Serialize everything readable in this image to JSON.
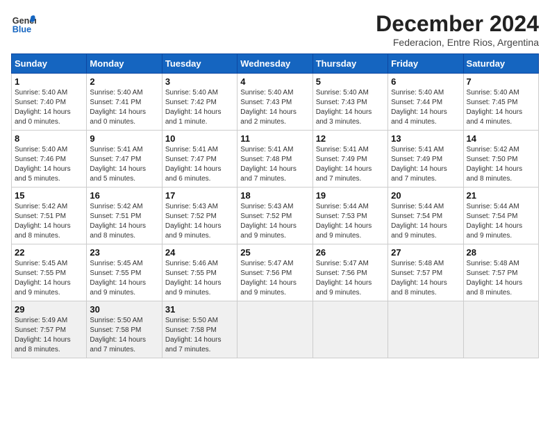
{
  "header": {
    "logo_general": "General",
    "logo_blue": "Blue",
    "month_title": "December 2024",
    "subtitle": "Federacion, Entre Rios, Argentina"
  },
  "calendar": {
    "weekdays": [
      "Sunday",
      "Monday",
      "Tuesday",
      "Wednesday",
      "Thursday",
      "Friday",
      "Saturday"
    ],
    "days": [
      {
        "date": "1",
        "col": 0,
        "info": "Sunrise: 5:40 AM\nSunset: 7:40 PM\nDaylight: 14 hours\nand 0 minutes."
      },
      {
        "date": "2",
        "col": 1,
        "info": "Sunrise: 5:40 AM\nSunset: 7:41 PM\nDaylight: 14 hours\nand 0 minutes."
      },
      {
        "date": "3",
        "col": 2,
        "info": "Sunrise: 5:40 AM\nSunset: 7:42 PM\nDaylight: 14 hours\nand 1 minute."
      },
      {
        "date": "4",
        "col": 3,
        "info": "Sunrise: 5:40 AM\nSunset: 7:43 PM\nDaylight: 14 hours\nand 2 minutes."
      },
      {
        "date": "5",
        "col": 4,
        "info": "Sunrise: 5:40 AM\nSunset: 7:43 PM\nDaylight: 14 hours\nand 3 minutes."
      },
      {
        "date": "6",
        "col": 5,
        "info": "Sunrise: 5:40 AM\nSunset: 7:44 PM\nDaylight: 14 hours\nand 4 minutes."
      },
      {
        "date": "7",
        "col": 6,
        "info": "Sunrise: 5:40 AM\nSunset: 7:45 PM\nDaylight: 14 hours\nand 4 minutes."
      },
      {
        "date": "8",
        "col": 0,
        "info": "Sunrise: 5:40 AM\nSunset: 7:46 PM\nDaylight: 14 hours\nand 5 minutes."
      },
      {
        "date": "9",
        "col": 1,
        "info": "Sunrise: 5:41 AM\nSunset: 7:47 PM\nDaylight: 14 hours\nand 5 minutes."
      },
      {
        "date": "10",
        "col": 2,
        "info": "Sunrise: 5:41 AM\nSunset: 7:47 PM\nDaylight: 14 hours\nand 6 minutes."
      },
      {
        "date": "11",
        "col": 3,
        "info": "Sunrise: 5:41 AM\nSunset: 7:48 PM\nDaylight: 14 hours\nand 7 minutes."
      },
      {
        "date": "12",
        "col": 4,
        "info": "Sunrise: 5:41 AM\nSunset: 7:49 PM\nDaylight: 14 hours\nand 7 minutes."
      },
      {
        "date": "13",
        "col": 5,
        "info": "Sunrise: 5:41 AM\nSunset: 7:49 PM\nDaylight: 14 hours\nand 7 minutes."
      },
      {
        "date": "14",
        "col": 6,
        "info": "Sunrise: 5:42 AM\nSunset: 7:50 PM\nDaylight: 14 hours\nand 8 minutes."
      },
      {
        "date": "15",
        "col": 0,
        "info": "Sunrise: 5:42 AM\nSunset: 7:51 PM\nDaylight: 14 hours\nand 8 minutes."
      },
      {
        "date": "16",
        "col": 1,
        "info": "Sunrise: 5:42 AM\nSunset: 7:51 PM\nDaylight: 14 hours\nand 8 minutes."
      },
      {
        "date": "17",
        "col": 2,
        "info": "Sunrise: 5:43 AM\nSunset: 7:52 PM\nDaylight: 14 hours\nand 9 minutes."
      },
      {
        "date": "18",
        "col": 3,
        "info": "Sunrise: 5:43 AM\nSunset: 7:52 PM\nDaylight: 14 hours\nand 9 minutes."
      },
      {
        "date": "19",
        "col": 4,
        "info": "Sunrise: 5:44 AM\nSunset: 7:53 PM\nDaylight: 14 hours\nand 9 minutes."
      },
      {
        "date": "20",
        "col": 5,
        "info": "Sunrise: 5:44 AM\nSunset: 7:54 PM\nDaylight: 14 hours\nand 9 minutes."
      },
      {
        "date": "21",
        "col": 6,
        "info": "Sunrise: 5:44 AM\nSunset: 7:54 PM\nDaylight: 14 hours\nand 9 minutes."
      },
      {
        "date": "22",
        "col": 0,
        "info": "Sunrise: 5:45 AM\nSunset: 7:55 PM\nDaylight: 14 hours\nand 9 minutes."
      },
      {
        "date": "23",
        "col": 1,
        "info": "Sunrise: 5:45 AM\nSunset: 7:55 PM\nDaylight: 14 hours\nand 9 minutes."
      },
      {
        "date": "24",
        "col": 2,
        "info": "Sunrise: 5:46 AM\nSunset: 7:55 PM\nDaylight: 14 hours\nand 9 minutes."
      },
      {
        "date": "25",
        "col": 3,
        "info": "Sunrise: 5:47 AM\nSunset: 7:56 PM\nDaylight: 14 hours\nand 9 minutes."
      },
      {
        "date": "26",
        "col": 4,
        "info": "Sunrise: 5:47 AM\nSunset: 7:56 PM\nDaylight: 14 hours\nand 9 minutes."
      },
      {
        "date": "27",
        "col": 5,
        "info": "Sunrise: 5:48 AM\nSunset: 7:57 PM\nDaylight: 14 hours\nand 8 minutes."
      },
      {
        "date": "28",
        "col": 6,
        "info": "Sunrise: 5:48 AM\nSunset: 7:57 PM\nDaylight: 14 hours\nand 8 minutes."
      },
      {
        "date": "29",
        "col": 0,
        "info": "Sunrise: 5:49 AM\nSunset: 7:57 PM\nDaylight: 14 hours\nand 8 minutes."
      },
      {
        "date": "30",
        "col": 1,
        "info": "Sunrise: 5:50 AM\nSunset: 7:58 PM\nDaylight: 14 hours\nand 7 minutes."
      },
      {
        "date": "31",
        "col": 2,
        "info": "Sunrise: 5:50 AM\nSunset: 7:58 PM\nDaylight: 14 hours\nand 7 minutes."
      }
    ]
  }
}
